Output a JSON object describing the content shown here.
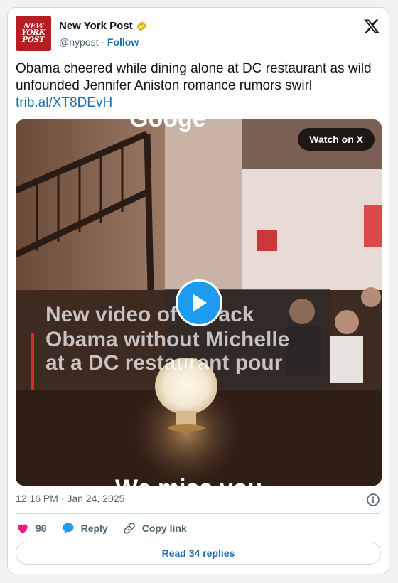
{
  "author": {
    "name": "New York Post",
    "handle": "@nypost",
    "separator": "·",
    "follow_label": "Follow",
    "avatar_text": [
      "NEW",
      "YORK",
      "POST"
    ]
  },
  "tweet": {
    "text": "Obama cheered while dining alone at DC restaurant as wild unfounded Jennifer Aniston romance rumors swirl",
    "link": "trib.al/XT8DEvH"
  },
  "media": {
    "watch_label": "Watch on X",
    "caption_lines": [
      "New video of Barack",
      "Obama without Michelle",
      "at a DC restaurant pour"
    ],
    "bottom_caption": "We miss you",
    "top_caption": "Googe"
  },
  "meta": {
    "timestamp": "12:16 PM · Jan 24, 2025"
  },
  "actions": {
    "likes": "98",
    "reply_label": "Reply",
    "copy_label": "Copy link"
  },
  "replies_button": "Read 34 replies",
  "colors": {
    "accent": "#1d9bf0",
    "brand": "#b81d23",
    "link": "#1a6fb0",
    "heart": "#f91880"
  }
}
